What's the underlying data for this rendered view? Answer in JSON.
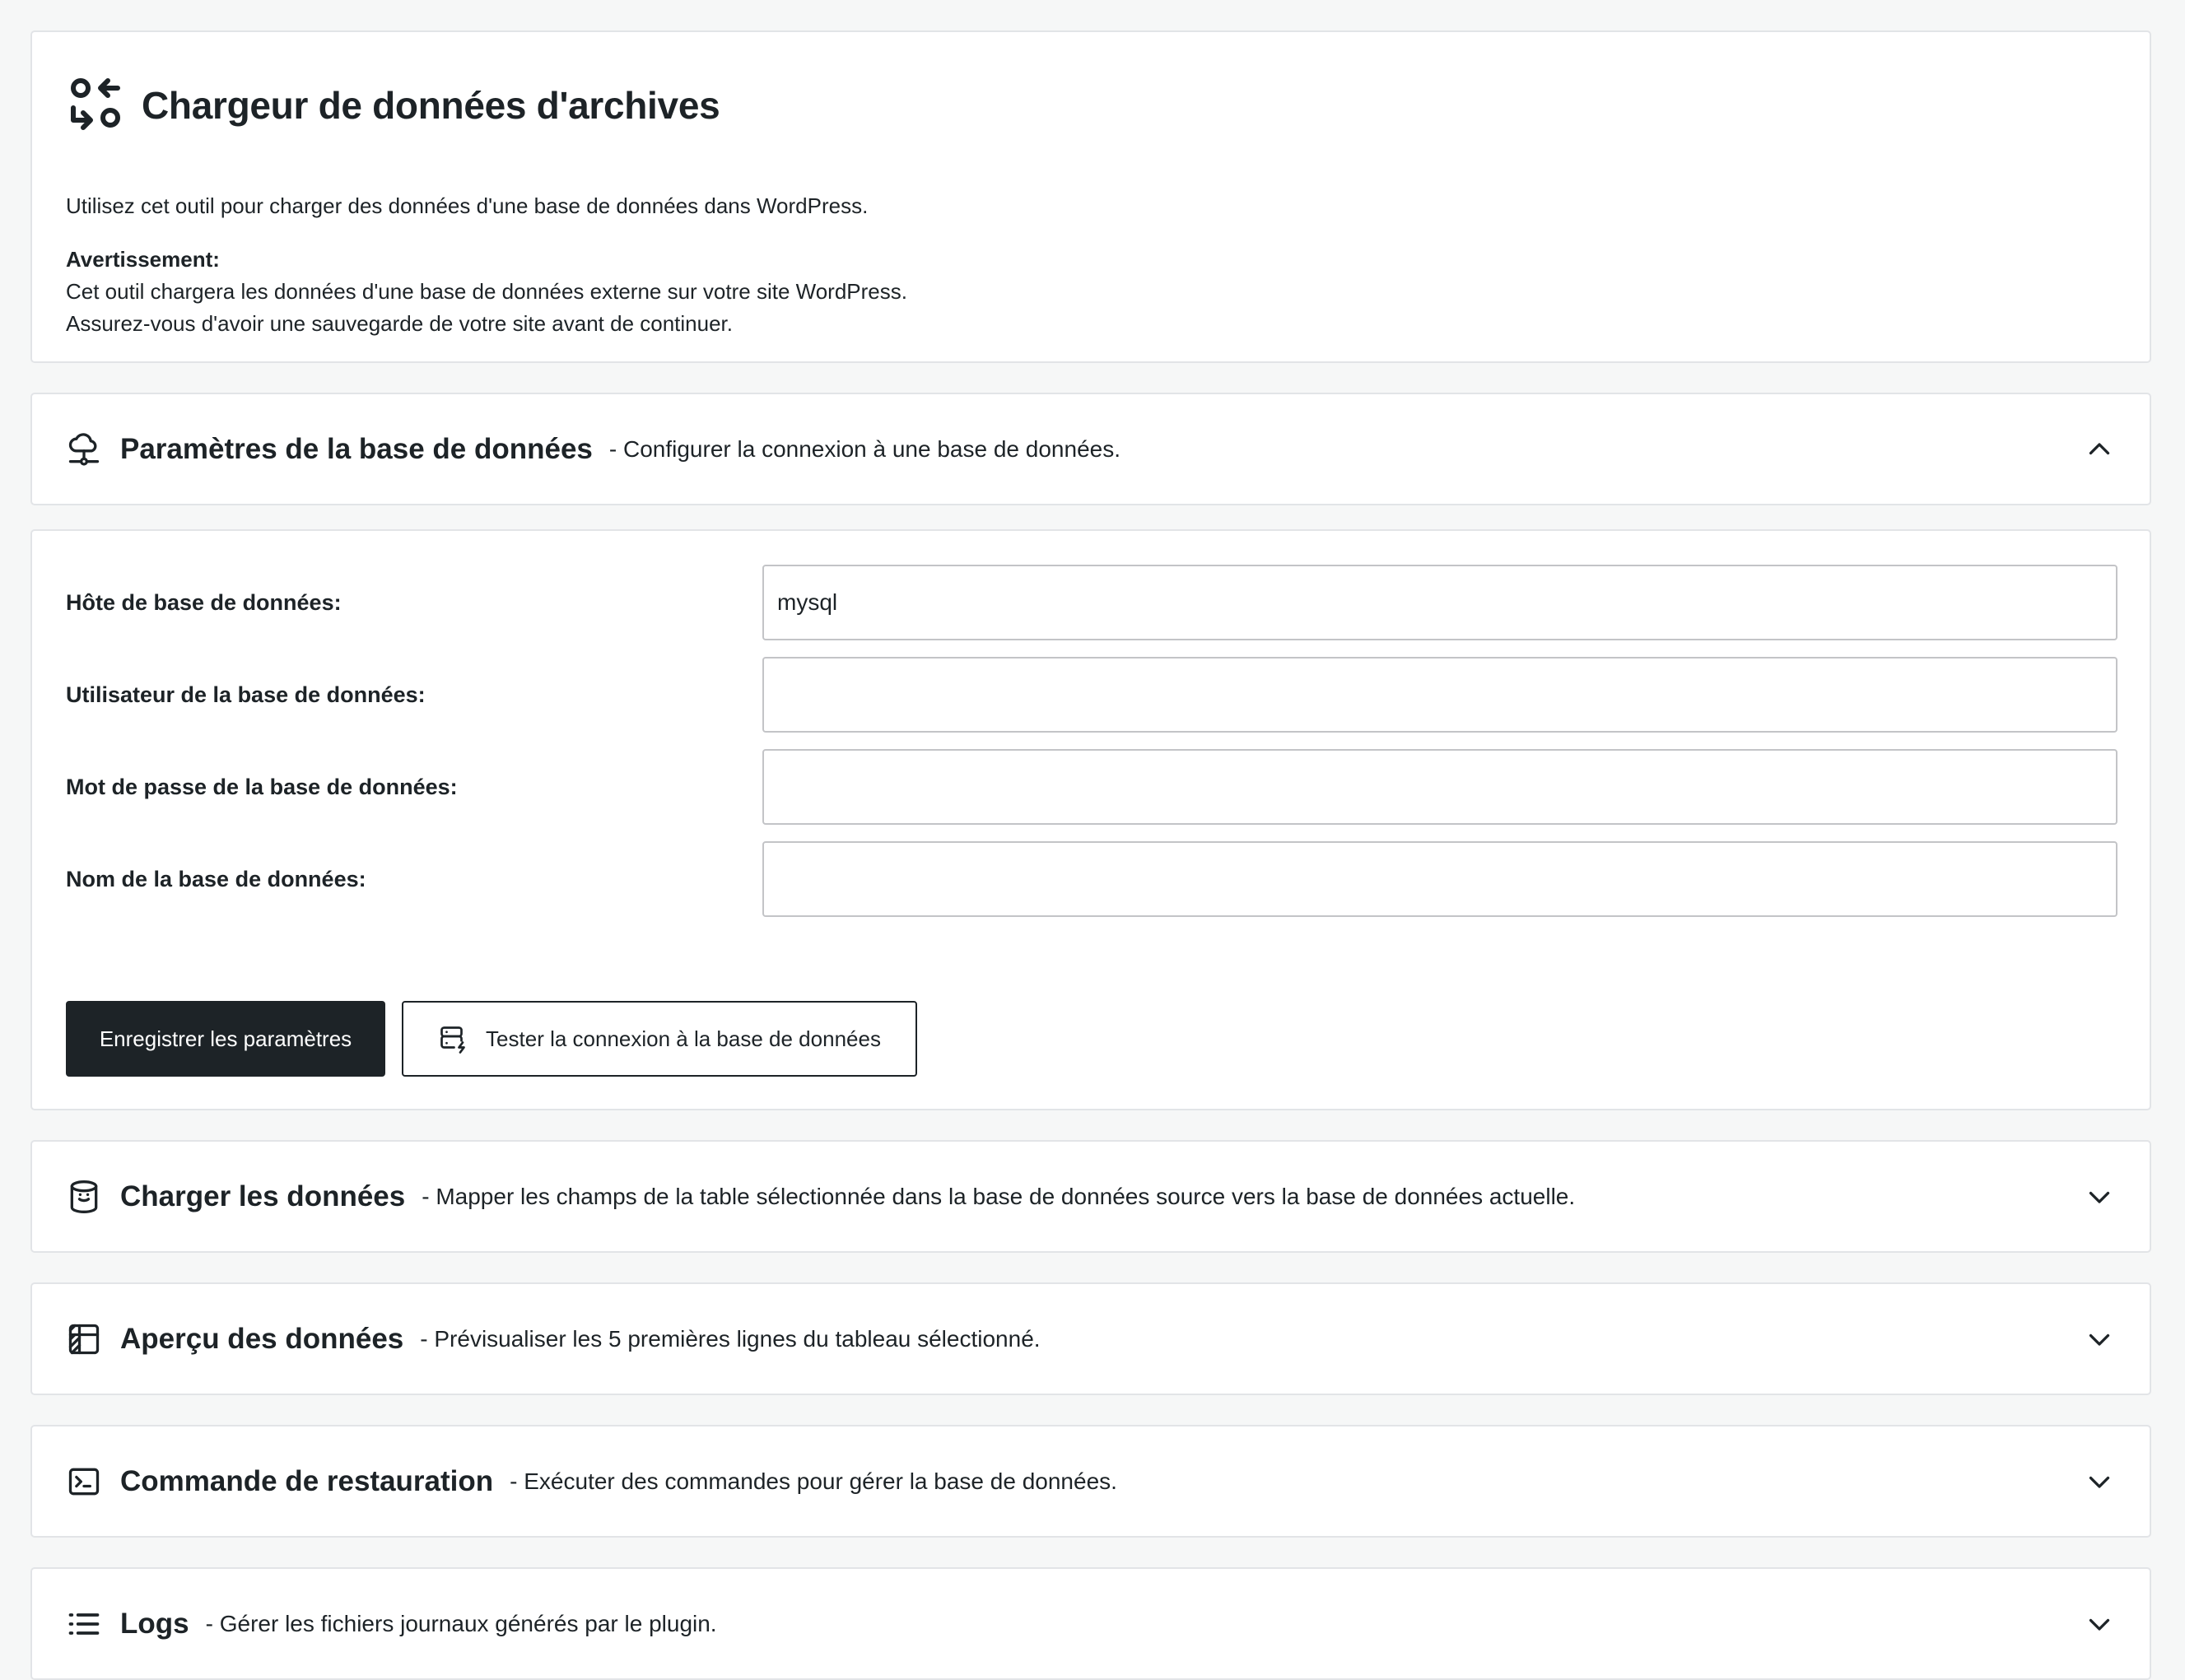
{
  "intro": {
    "title": "Chargeur de données d'archives",
    "icon": "arrows-swap-icon",
    "description": "Utilisez cet outil pour charger des données d'une base de données dans WordPress.",
    "warning_title": "Avertissement:",
    "warning_line1": "Cet outil chargera les données d'une base de données externe sur votre site WordPress.",
    "warning_line2": "Assurez-vous d'avoir une sauvegarde de votre site avant de continuer."
  },
  "settings": {
    "icon": "cloud-network-icon",
    "title": "Paramètres de la base de données",
    "description": "- Configurer la connexion à une base de données.",
    "expanded": true,
    "fields": {
      "host_label": "Hôte de base de données:",
      "host_value": "mysql",
      "user_label": "Utilisateur de la base de données:",
      "user_value": "",
      "password_label": "Mot de passe de la base de données:",
      "password_value": "",
      "name_label": "Nom de la base de données:",
      "name_value": ""
    },
    "save_label": "Enregistrer les paramètres",
    "test_label": "Tester la connexion à la base de données",
    "test_icon": "server-test-icon"
  },
  "load": {
    "icon": "database-icon",
    "title": "Charger les données",
    "description": "- Mapper les champs de la table sélectionnée dans la base de données source vers la base de données actuelle."
  },
  "preview": {
    "icon": "table-icon",
    "title": "Aperçu des données",
    "description": "- Prévisualiser les 5 premières lignes du tableau sélectionné."
  },
  "restore": {
    "icon": "terminal-icon",
    "title": "Commande de restauration",
    "description": "- Exécuter des commandes pour gérer la base de données."
  },
  "logs": {
    "icon": "list-icon",
    "title": "Logs",
    "description": "- Gérer les fichiers journaux générés par le plugin."
  },
  "colors": {
    "background": "#f6f7f7",
    "card": "#ffffff",
    "border": "#e2e4e7",
    "text": "#1d2327",
    "primary_button": "#1d2327"
  }
}
